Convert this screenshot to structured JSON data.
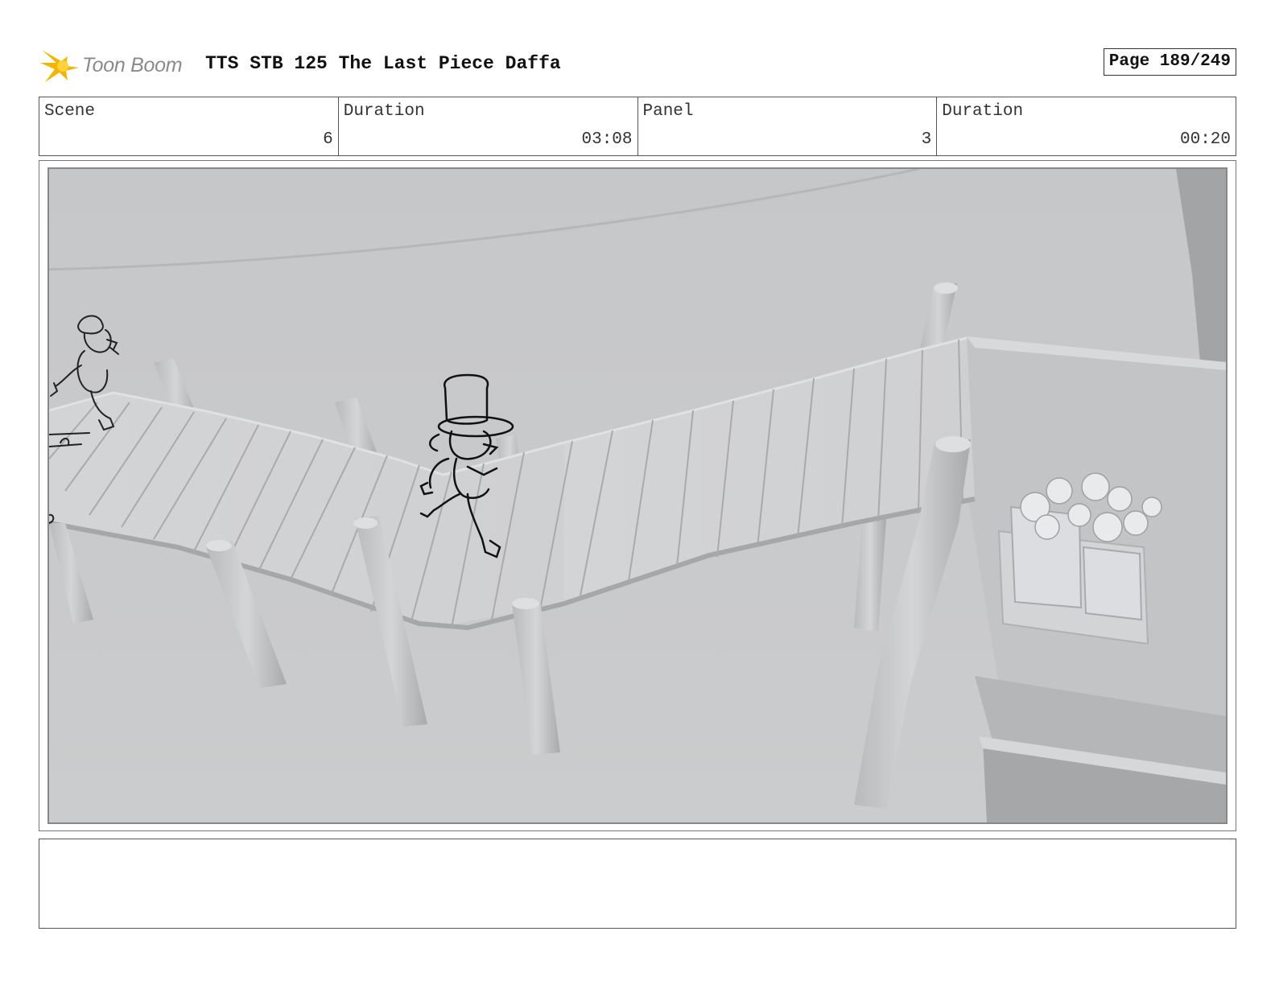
{
  "header": {
    "logo_text": "Toon Boom",
    "logo_icon": "starburst-icon",
    "title": "TTS STB 125 The Last Piece Daffa",
    "page_label": "Page 189/249"
  },
  "info": {
    "scene_label": "Scene",
    "scene_value": "6",
    "scene_duration_label": "Duration",
    "scene_duration_value": "03:08",
    "panel_label": "Panel",
    "panel_value": "3",
    "panel_duration_label": "Duration",
    "panel_duration_value": "00:20"
  },
  "notes": {
    "text": ""
  },
  "colors": {
    "logo_accent": "#f5b400",
    "background_gray": "#c8c9cb"
  }
}
